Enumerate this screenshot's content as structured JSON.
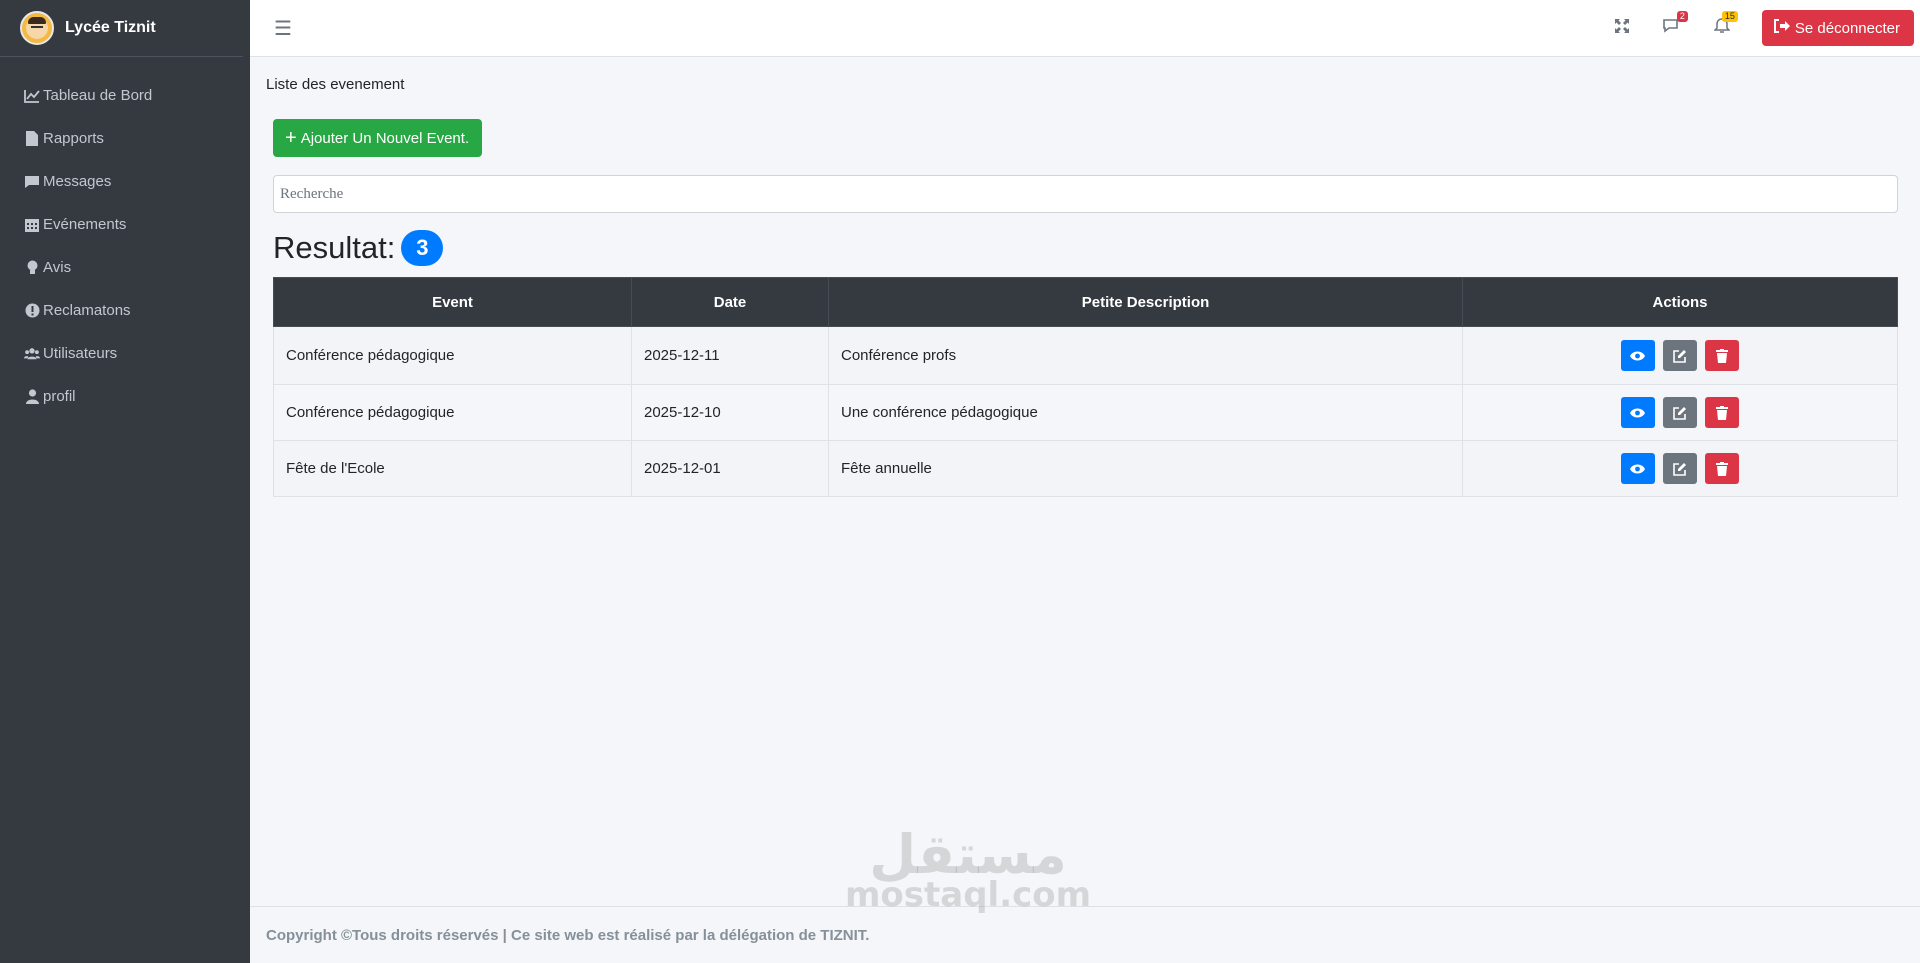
{
  "brand": {
    "title": "Lycée Tiznit"
  },
  "sidebar": {
    "items": [
      {
        "label": "Tableau de Bord",
        "icon": "chart-line-icon"
      },
      {
        "label": "Rapports",
        "icon": "file-icon"
      },
      {
        "label": "Messages",
        "icon": "comment-icon"
      },
      {
        "label": "Evénements",
        "icon": "calendar-icon"
      },
      {
        "label": "Avis",
        "icon": "lightbulb-icon"
      },
      {
        "label": "Reclamatons",
        "icon": "exclamation-circle-icon"
      },
      {
        "label": "Utilisateurs",
        "icon": "users-icon"
      },
      {
        "label": "profil",
        "icon": "user-icon"
      }
    ]
  },
  "topbar": {
    "messages_badge": "2",
    "notifications_badge": "15",
    "logout_label": "Se déconnecter"
  },
  "main": {
    "page_title": "Liste des evenement",
    "add_button": "Ajouter Un Nouvel Event.",
    "search_placeholder": "Recherche",
    "result_label": "Resultat:",
    "result_count": "3"
  },
  "table": {
    "headers": [
      "Event",
      "Date",
      "Petite Description",
      "Actions"
    ],
    "rows": [
      {
        "event": "Conférence pédagogique",
        "date": "2025-12-11",
        "description": "Conférence profs"
      },
      {
        "event": "Conférence pédagogique",
        "date": "2025-12-10",
        "description": "Une conférence pédagogique"
      },
      {
        "event": "Fête de l'Ecole",
        "date": "2025-12-01",
        "description": "Fête annuelle"
      }
    ]
  },
  "footer": {
    "text": "Copyright ©Tous droits réservés | Ce site web est réalisé par la délégation de TIZNIT."
  },
  "watermark": {
    "arabic": "مستقل",
    "latin": "mostaql.com"
  },
  "colors": {
    "sidebar": "#343a40",
    "primary": "#007bff",
    "success": "#28a745",
    "danger": "#dc3545",
    "secondary": "#6c757d"
  }
}
